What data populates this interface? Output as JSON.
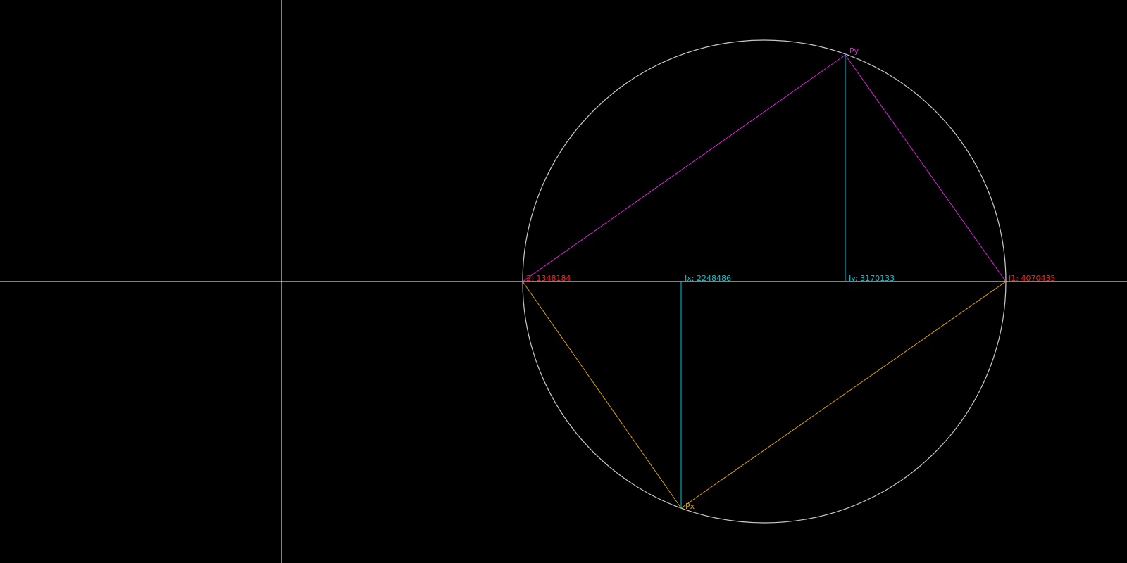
{
  "labels": {
    "i1": "I1: 4070435",
    "i2": "I2: 1348184",
    "ix": "Ix: 2248486",
    "iy": "Iy: 3170133",
    "px": "Px",
    "py": "Py"
  },
  "colors": {
    "background": "#000000",
    "axes": "#ffffff",
    "circle": "#c8c8c8",
    "principal_labels": "#ff2020",
    "projection": "#00c8d8",
    "py_chord": "#e020e0",
    "px_chord": "#e0a000"
  }
}
